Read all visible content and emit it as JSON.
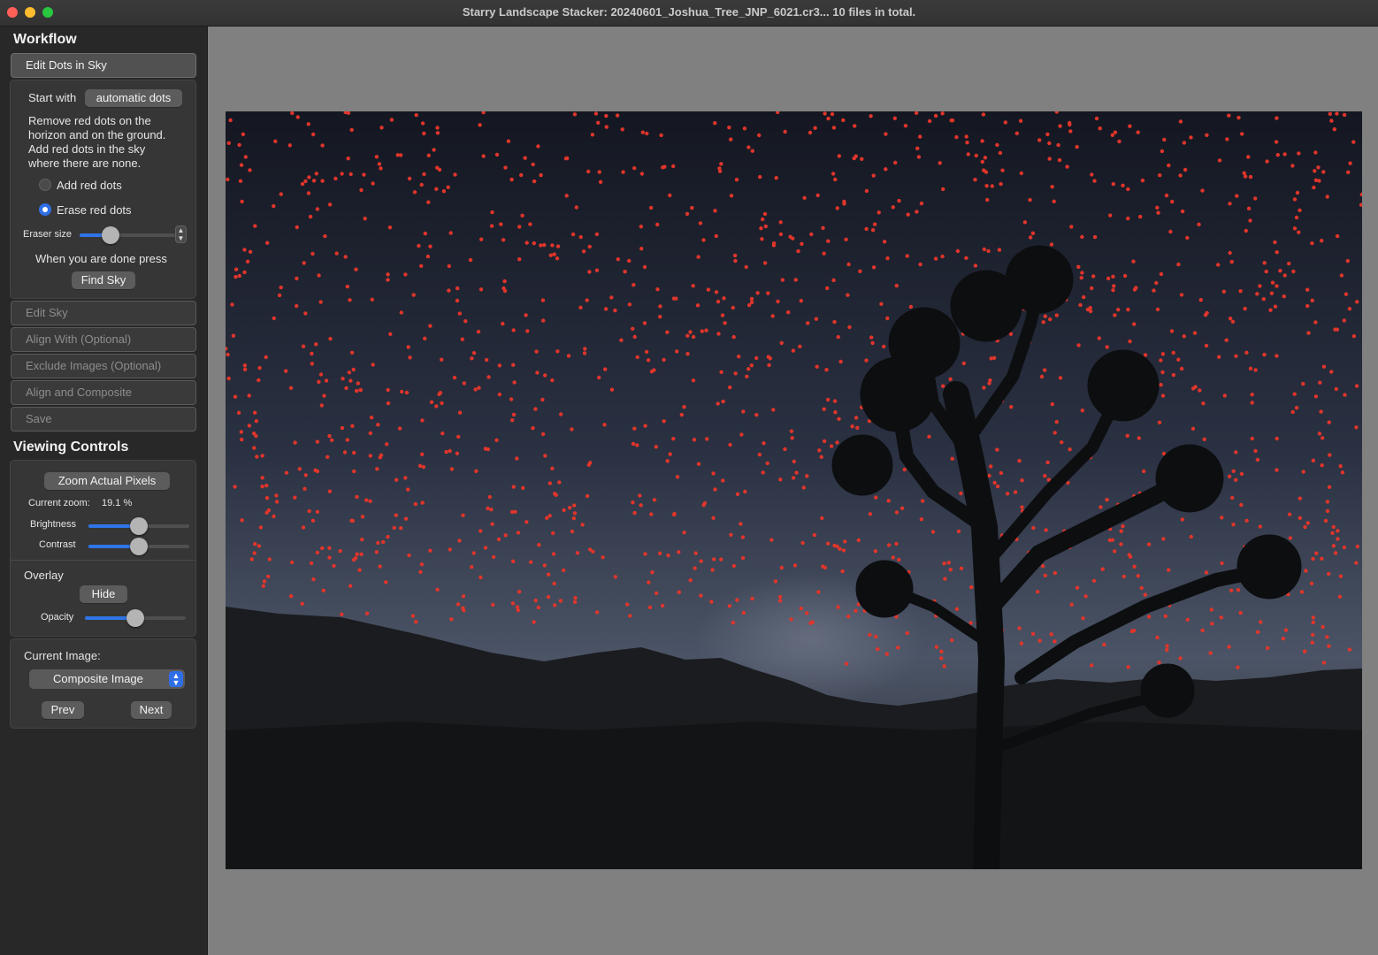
{
  "window": {
    "title": "Starry Landscape Stacker: 20240601_Joshua_Tree_JNP_6021.cr3...  10 files in total."
  },
  "workflow": {
    "heading": "Workflow",
    "active_step": "Edit Dots in Sky",
    "start_with_label": "Start with",
    "start_with_button": "automatic dots",
    "instructions": [
      "Remove red dots on the",
      "horizon and on the ground.",
      "Add red dots in the sky",
      "where there are none."
    ],
    "mode_options": [
      {
        "label": "Add red dots",
        "selected": false
      },
      {
        "label": "Erase red dots",
        "selected": true
      }
    ],
    "eraser_size_label": "Eraser size",
    "eraser_size_fraction": 0.32,
    "done_text": "When you are done press",
    "find_sky_button": "Find Sky",
    "steps": [
      "Edit Sky",
      "Align With (Optional)",
      "Exclude Images (Optional)",
      "Align and Composite",
      "Save"
    ]
  },
  "viewing": {
    "heading": "Viewing Controls",
    "zoom_button": "Zoom Actual Pixels",
    "zoom_label": "Current zoom:",
    "zoom_value": "19.1 %",
    "brightness_label": "Brightness",
    "brightness_fraction": 0.5,
    "contrast_label": "Contrast",
    "contrast_fraction": 0.5,
    "overlay_label": "Overlay",
    "overlay_button": "Hide",
    "opacity_label": "Opacity",
    "opacity_fraction": 0.5
  },
  "current_image": {
    "label": "Current Image:",
    "selected": "Composite Image",
    "prev_button": "Prev",
    "next_button": "Next"
  },
  "colors": {
    "accent": "#2f6ee6",
    "dot": "#e0352b",
    "canvas_bg": "#808080"
  }
}
